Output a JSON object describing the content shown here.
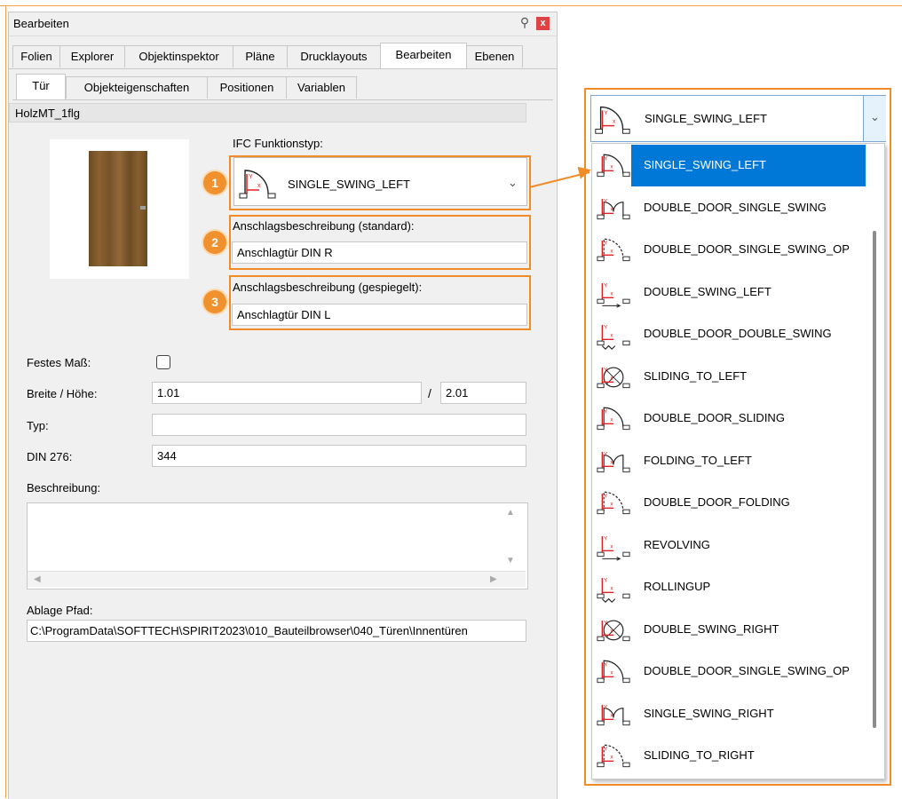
{
  "panel": {
    "title": "Bearbeiten",
    "close_label": "x",
    "tabs": [
      "Folien",
      "Explorer",
      "Objektinspektor",
      "Pläne",
      "Drucklayouts",
      "Bearbeiten",
      "Ebenen"
    ],
    "subtabs": [
      "Tür",
      "Objekteigenschaften",
      "Positionen",
      "Variablen"
    ]
  },
  "object": {
    "name": "HolzMT_1flg"
  },
  "ifc": {
    "label": "IFC Funktionstyp:",
    "value": "SINGLE_SWING_LEFT"
  },
  "anschlag": {
    "standard_label": "Anschlagsbeschreibung (standard):",
    "standard_value": "Anschlagtür DIN R",
    "mirrored_label": "Anschlagsbeschreibung (gespiegelt):",
    "mirrored_value": "Anschlagtür DIN L"
  },
  "badges": [
    "1",
    "2",
    "3"
  ],
  "fields": {
    "festes_mass_label": "Festes Maß:",
    "festes_mass_checked": false,
    "breite_hoehe_label": "Breite / Höhe:",
    "breite": "1.01",
    "separator": "/",
    "hoehe": "2.01",
    "typ_label": "Typ:",
    "typ": "",
    "din276_label": "DIN 276:",
    "din276": "344",
    "beschreibung_label": "Beschreibung:",
    "beschreibung": "",
    "ablage_label": "Ablage Pfad:",
    "ablage": "C:\\ProgramData\\SOFTTECH\\SPIRIT2023\\010_Bauteilbrowser\\040_Türen\\Innentüren"
  },
  "dropdown": {
    "selected": "SINGLE_SWING_LEFT",
    "items": [
      "SINGLE_SWING_LEFT",
      "DOUBLE_DOOR_SINGLE_SWING",
      "DOUBLE_DOOR_SINGLE_SWING_OP",
      "DOUBLE_SWING_LEFT",
      "DOUBLE_DOOR_DOUBLE_SWING",
      "SLIDING_TO_LEFT",
      "DOUBLE_DOOR_SLIDING",
      "FOLDING_TO_LEFT",
      "DOUBLE_DOOR_FOLDING",
      "REVOLVING",
      "ROLLINGUP",
      "DOUBLE_SWING_RIGHT",
      "DOUBLE_DOOR_SINGLE_SWING_OP",
      "SINGLE_SWING_RIGHT",
      "SLIDING_TO_RIGHT"
    ]
  },
  "colors": {
    "accent_orange": "#f08c28",
    "selection_blue": "#0078d7",
    "close_red": "#e04343"
  }
}
